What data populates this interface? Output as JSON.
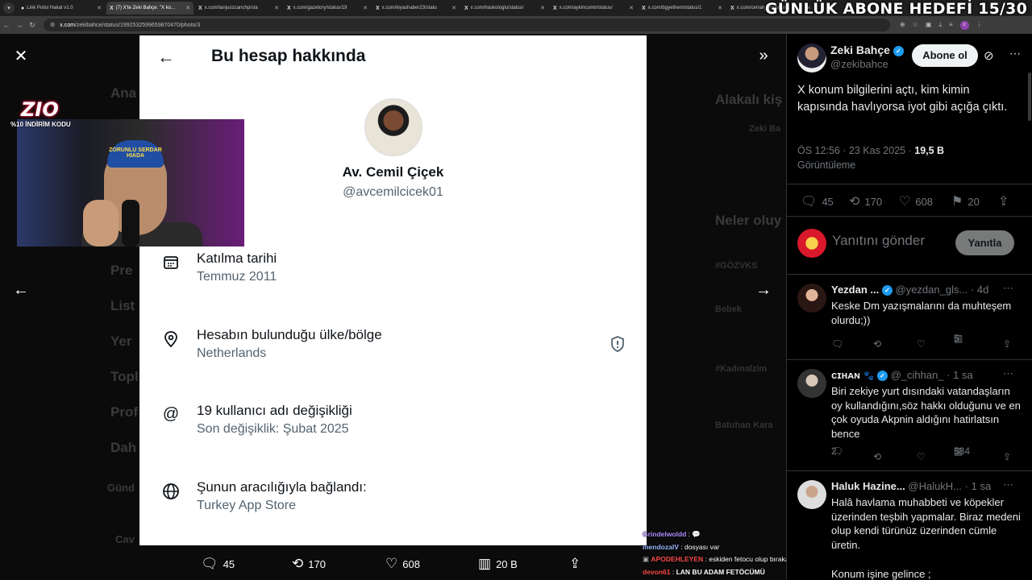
{
  "browser": {
    "tabs": [
      {
        "label": "Link Polisi Hakat v1.0",
        "active": false
      },
      {
        "label": "(7) X'te Zeki Bahçe: \"X ko...",
        "active": true
      },
      {
        "label": "x.com/tanjuozcanchp/sta",
        "active": false
      },
      {
        "label": "x.com/gazetory/status/19",
        "active": false
      },
      {
        "label": "x.com/kiyashaber23/statu",
        "active": false
      },
      {
        "label": "x.com/haskologlu/status/",
        "active": false
      },
      {
        "label": "x.com/aykiricomtr/status/",
        "active": false
      },
      {
        "label": "x.com/bgyethem/status/1",
        "active": false
      },
      {
        "label": "x.com/cerrah_trr/status/1",
        "active": false
      }
    ],
    "url_domain": "x.com",
    "url_path": "/zekibahce/status/1992532599659870470/photo/3"
  },
  "overlay": {
    "goal_banner": "GÜNLÜK ABONE HEDEFİ 15/30",
    "logo_text": "ZIO",
    "promo_text": "%10 İNDİRİM KODU",
    "cap_text": "ZORUNLU SERDAR HIADA"
  },
  "background_page": {
    "nav_fragments": [
      "Ana",
      "Pre",
      "List",
      "Yer",
      "Topl",
      "Prof",
      "Dah",
      "Günd",
      "Cav"
    ],
    "side_fragments": [
      "Alakalı kiş",
      "Zeki Ba",
      "Neler oluy",
      "#GÖZVKS",
      "Bebek",
      "#Kadınalzim",
      "Batuhan Kara"
    ]
  },
  "about_card": {
    "title": "Bu hesap hakkında",
    "name": "Av. Cemil Çiçek",
    "handle": "@avcemilcicek01",
    "rows": [
      {
        "label": "Katılma tarihi",
        "value": "Temmuz 2011"
      },
      {
        "label": "Hesabın bulunduğu ülke/bölge",
        "value": "Netherlands"
      },
      {
        "label": "19 kullanıcı adı değişikliği",
        "value": "Son değişiklik: Şubat 2025"
      },
      {
        "label": "Şunun aracılığıyla bağlandı:",
        "value": "Turkey App Store"
      }
    ]
  },
  "photo_actions": {
    "replies": "45",
    "reposts": "170",
    "likes": "608",
    "views": "20 B"
  },
  "chat": [
    {
      "user": "Grindelwoldd",
      "color": "#b18cff",
      "msg": "💬"
    },
    {
      "user": "mendozalV",
      "color": "#9ab6ff",
      "msg": "dosyası var"
    },
    {
      "user": "APODEHLEYEN",
      "color": "#ff4a4a",
      "msg": "eskiden fetocu olup bırakan"
    },
    {
      "user": "devon61",
      "color": "#ff4a4a",
      "msg": "LAN BU ADAM FETÖCÜMÜ"
    }
  ],
  "tweet": {
    "author": "Zeki Bahçe",
    "handle": "@zekibahce",
    "follow_label": "Abone ol",
    "text": "X konum bilgilerini açtı, kim kimin kapısında havlıyorsa iyot gibi açığa çıktı.",
    "time": "ÖS 12:56 · 23 Kas 2025 ·",
    "views": "19,5 B",
    "views_label": "Görüntüleme",
    "replies": "45",
    "reposts": "170",
    "likes": "608",
    "bookmarks": "20",
    "reply_placeholder": "Yanıtını gönder",
    "reply_button": "Yanıtla"
  },
  "replies": [
    {
      "name": "Yezdan ...",
      "handle": "@yezdan_gls...",
      "time": "· 4d",
      "text": "Keske Dm yazışmalarını da muhteşem olurdu;))",
      "replies": "",
      "views": "5"
    },
    {
      "name": "ᴄɪʜᴀɴ",
      "handle": "@_cihhan_",
      "time": "· 1 sa",
      "text": "Biri zekiye yurt dısındaki vatandaşların oy kullandığını,söz hakkı olduğunu ve en çok oyuda Akpnin aldığını hatirlatsın bence",
      "replies": "2",
      "views": "584"
    },
    {
      "name": "Haluk Hazine...",
      "handle": "@HalukH...",
      "time": "· 1 sa",
      "text": "Halâ havlama muhabbeti ve köpekler üzerinden teşbih yapmalar. Biraz medeni olup kendi türünüz üzerinden cümle üretin.",
      "replies": "",
      "views": ""
    }
  ],
  "reply_extra_line": "Konum işine gelince ;",
  "colors": {
    "accent": "#1d9bf0",
    "card_bg": "#ffffff",
    "muted": "#71767b"
  }
}
